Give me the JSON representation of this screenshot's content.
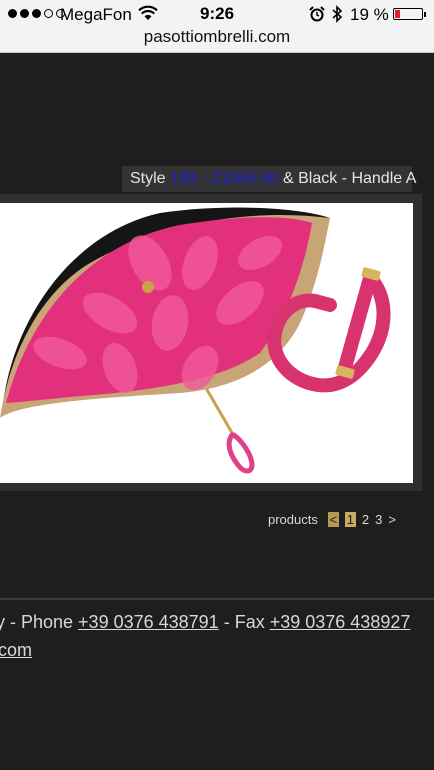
{
  "status_bar": {
    "carrier": "MegaFon",
    "time": "9:26",
    "battery_percent": "19 %",
    "battery_level": 0.19,
    "signal_bars_filled": 3,
    "signal_bars_total": 5,
    "icons": [
      "wifi-icon",
      "alarm-icon",
      "bluetooth-icon",
      "battery-icon"
    ]
  },
  "browser": {
    "url": "pasottiombrelli.com"
  },
  "product": {
    "caption_prefix": "Style ",
    "caption_code": "189 - 21065-30",
    "caption_suffix": " & Black - Handle A",
    "image_alt": "Umbrella with pink dahlia pattern and pink handle"
  },
  "pagination": {
    "label": "products",
    "prev": "<",
    "pages": [
      "1",
      "2",
      "3"
    ],
    "current": "1",
    "next": ">"
  },
  "footer": {
    "line1_prefix": "y - Phone ",
    "phone": "+39 0376 438791",
    "fax_label": " - Fax ",
    "fax": "+39 0376 438927",
    "line2": "com"
  },
  "colors": {
    "background": "#1e1e1e",
    "accent_gold": "#c9ab5e",
    "link_code": "#1a1ad8"
  }
}
